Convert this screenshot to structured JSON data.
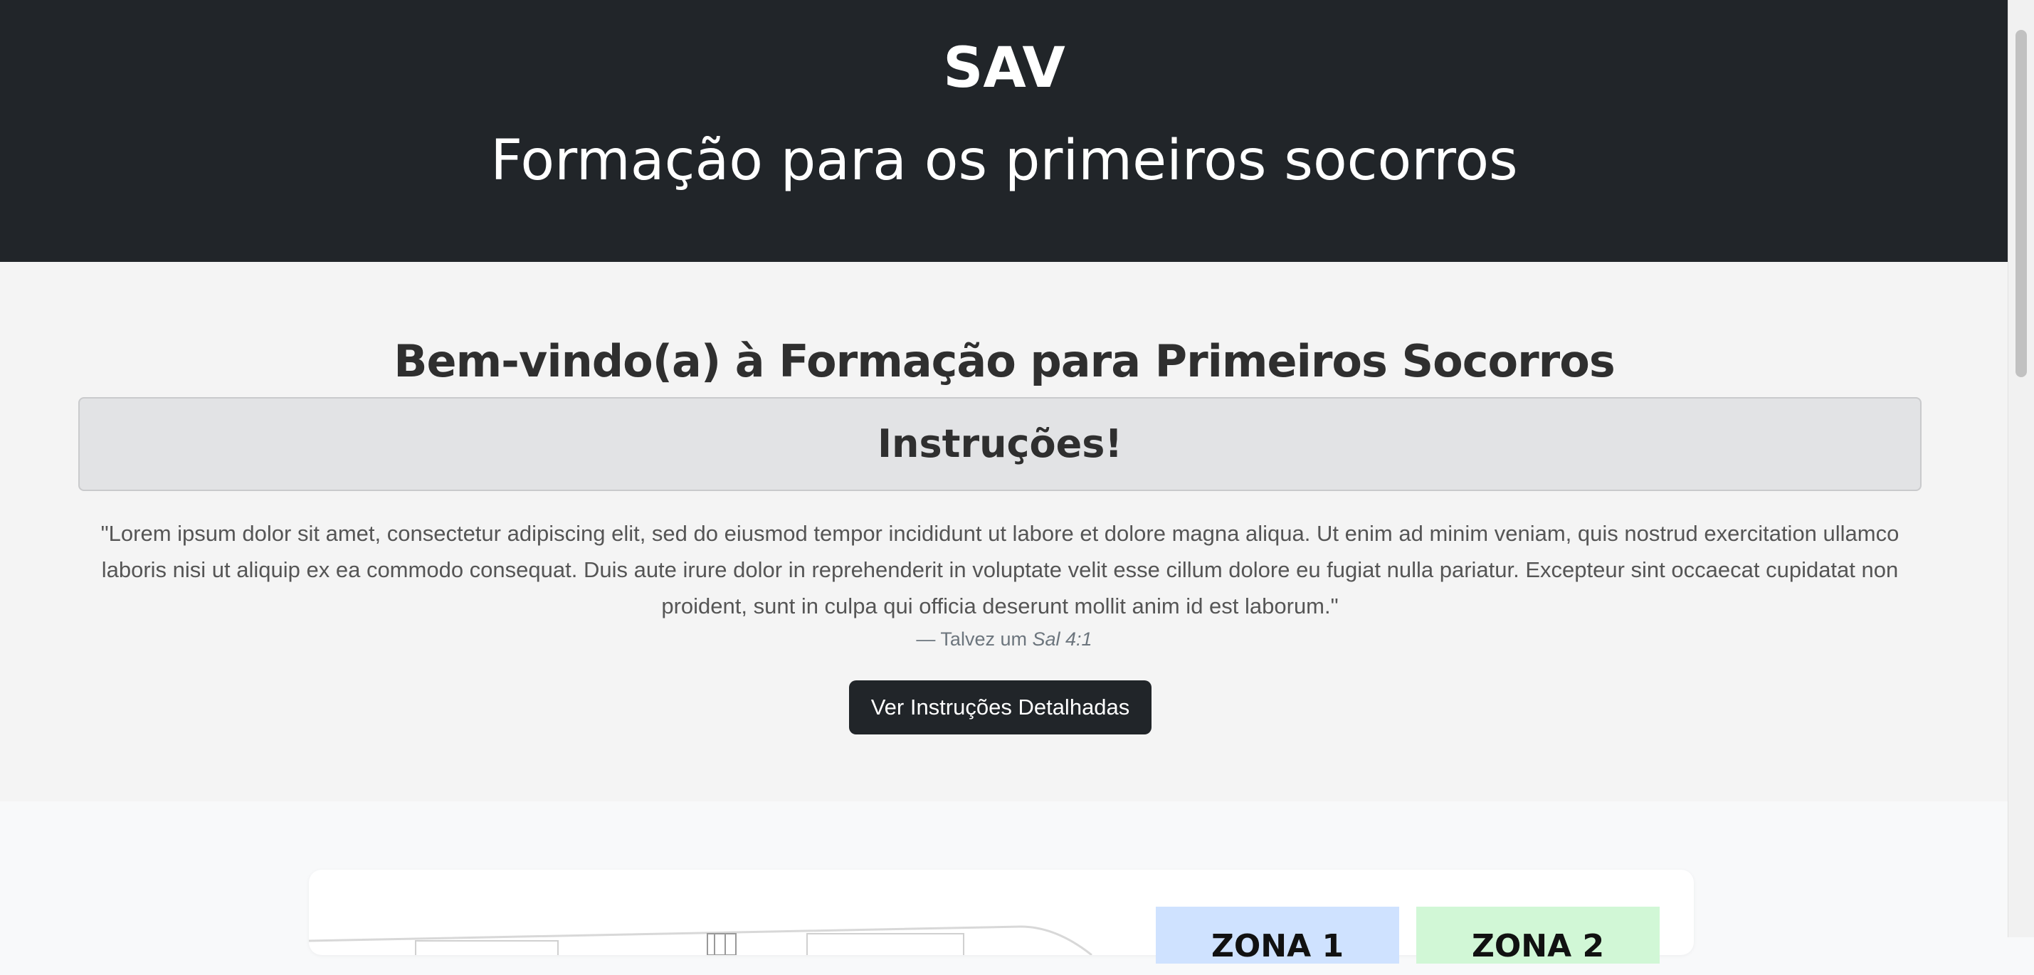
{
  "header": {
    "brand": "SAV",
    "subtitle": "Formação para os primeiros socorros"
  },
  "welcome": {
    "title": "Bem-vindo(a) à Formação para Primeiros Socorros",
    "instructions_title": "Instruções!",
    "quote": "\"Lorem ipsum dolor sit amet, consectetur adipiscing elit, sed do eiusmod tempor incididunt ut labore et dolore magna aliqua. Ut enim ad minim veniam, quis nostrud exercitation ullamco laboris nisi ut aliquip ex ea commodo consequat. Duis aute irure dolor in reprehenderit in voluptate velit esse cillum dolore eu fugiat nulla pariatur. Excepteur sint occaecat cupidatat non proident, sunt in culpa qui officia deserunt mollit anim id est laborum.\"",
    "cite_prefix": "— Talvez um",
    "cite_source": "Sal 4:1",
    "button_label": "Ver Instruções Detalhadas"
  },
  "zones": [
    {
      "label": "ZONA 1",
      "color": "#cfe2ff"
    },
    {
      "label": "ZONA 2",
      "color": "#d1f7d6"
    }
  ],
  "colors": {
    "header_bg": "#212529",
    "section_bg": "#f4f4f4",
    "instructions_bg": "#e2e3e5",
    "button_bg": "#212529"
  }
}
